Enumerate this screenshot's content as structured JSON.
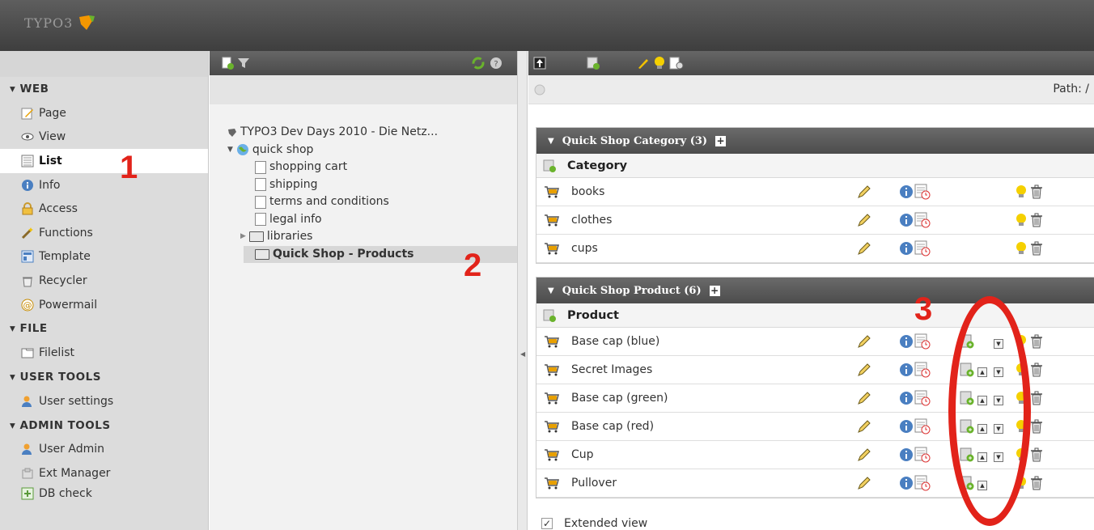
{
  "app": {
    "logo_text": "TYPO3"
  },
  "module_menu": {
    "sections": [
      {
        "title": "▾ WEB",
        "items": [
          {
            "label": "Page",
            "icon": "page-edit-icon",
            "active": false
          },
          {
            "label": "View",
            "icon": "eye-icon",
            "active": false
          },
          {
            "label": "List",
            "icon": "list-icon",
            "active": true
          },
          {
            "label": "Info",
            "icon": "info-icon",
            "active": false
          },
          {
            "label": "Access",
            "icon": "lock-icon",
            "active": false
          },
          {
            "label": "Functions",
            "icon": "wand-icon",
            "active": false
          },
          {
            "label": "Template",
            "icon": "template-icon",
            "active": false
          },
          {
            "label": "Recycler",
            "icon": "recycler-icon",
            "active": false
          },
          {
            "label": "Powermail",
            "icon": "powermail-icon",
            "active": false
          }
        ]
      },
      {
        "title": "▾ FILE",
        "items": [
          {
            "label": "Filelist",
            "icon": "filelist-icon",
            "active": false
          }
        ]
      },
      {
        "title": "▾ USER TOOLS",
        "items": [
          {
            "label": "User settings",
            "icon": "user-settings-icon",
            "active": false
          }
        ]
      },
      {
        "title": "▾ ADMIN TOOLS",
        "items": [
          {
            "label": "User Admin",
            "icon": "user-admin-icon",
            "active": false
          },
          {
            "label": "Ext Manager",
            "icon": "ext-manager-icon",
            "active": false
          },
          {
            "label": "DB check",
            "icon": "db-check-icon",
            "active": false
          }
        ]
      }
    ]
  },
  "page_tree": {
    "root": "TYPO3 Dev Days 2010 - Die Netz...",
    "site": "quick shop",
    "pages": [
      "shopping cart",
      "shipping",
      "terms and conditions",
      "legal info"
    ],
    "folder": "libraries",
    "selected": "Quick Shop - Products"
  },
  "content": {
    "path_label": "Path: /",
    "tables": [
      {
        "header": "Quick Shop Category (3)",
        "column": "Category",
        "rows": [
          "books",
          "clothes",
          "cups"
        ]
      },
      {
        "header": "Quick Shop Product (6)",
        "column": "Product",
        "rows": [
          "Base cap (blue)",
          "Secret Images",
          "Base cap (green)",
          "Base cap (red)",
          "Cup",
          "Pullover"
        ]
      }
    ],
    "extended_view_label": "Extended view",
    "extended_view_checked": "✓"
  },
  "annotations": {
    "one": "1",
    "two": "2",
    "three": "3"
  },
  "colors": {
    "topbar": "#4a4a4a",
    "annotation": "#e2231a",
    "active_bg": "#ffffff"
  }
}
